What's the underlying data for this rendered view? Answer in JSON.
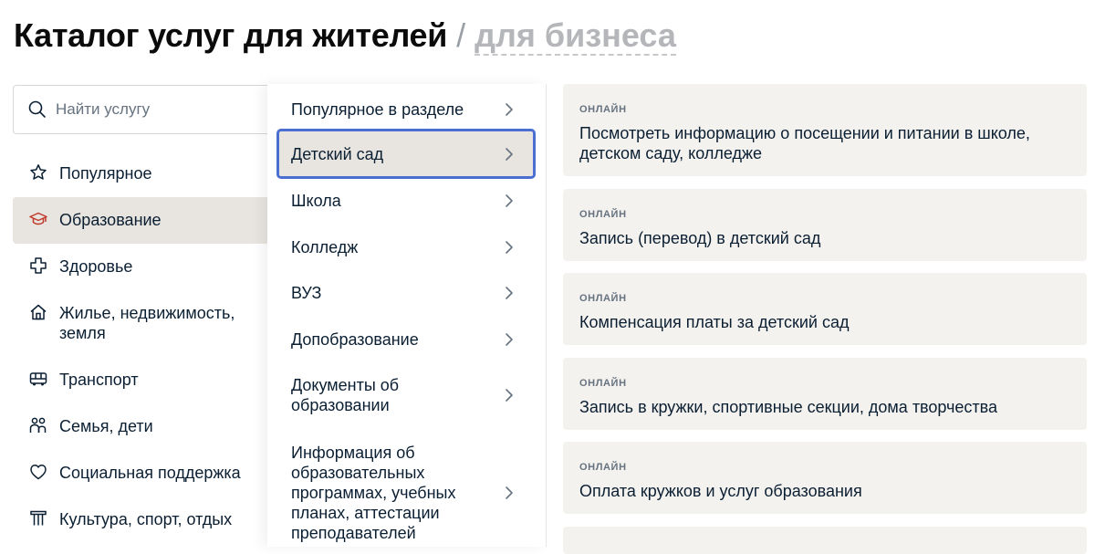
{
  "header": {
    "title": "Каталог услуг для жителей",
    "separator": "/",
    "alt_link": "для бизнеса"
  },
  "search": {
    "placeholder": "Найти услугу",
    "value": ""
  },
  "categories": [
    {
      "label": "Популярное",
      "icon": "star-icon"
    },
    {
      "label": "Образование",
      "icon": "graduation-cap-icon",
      "active": true
    },
    {
      "label": "Здоровье",
      "icon": "medical-cross-icon"
    },
    {
      "label": "Жилье, недвижимость, земля",
      "icon": "house-icon"
    },
    {
      "label": "Транспорт",
      "icon": "bus-icon"
    },
    {
      "label": "Семья, дети",
      "icon": "family-icon"
    },
    {
      "label": "Социальная поддержка",
      "icon": "heart-icon"
    },
    {
      "label": "Культура, спорт, отдых",
      "icon": "theater-icon"
    }
  ],
  "subcategories": [
    {
      "label": "Популярное в разделе"
    },
    {
      "label": "Детский сад",
      "active": true
    },
    {
      "label": "Школа"
    },
    {
      "label": "Колледж"
    },
    {
      "label": "ВУЗ"
    },
    {
      "label": "Допобразование"
    },
    {
      "label": "Документы об образовании"
    },
    {
      "label": "Информация об образовательных программах, учебных планах, аттестации преподавателей"
    }
  ],
  "services": [
    {
      "badge": "ОНЛАЙН",
      "title": "Посмотреть информацию о посещении и питании в школе, детском саду, колледже"
    },
    {
      "badge": "ОНЛАЙН",
      "title": "Запись (перевод) в детский сад"
    },
    {
      "badge": "ОНЛАЙН",
      "title": "Компенсация платы за детский сад"
    },
    {
      "badge": "ОНЛАЙН",
      "title": "Запись в кружки, спортивные секции, дома творчества"
    },
    {
      "badge": "ОНЛАЙН",
      "title": "Оплата кружков и услуг образования"
    }
  ],
  "colors": {
    "accent_red": "#c0392b",
    "active_bg": "#e8e4df",
    "focus_border": "#4a6ed1",
    "card_bg": "#f4f2ee"
  }
}
